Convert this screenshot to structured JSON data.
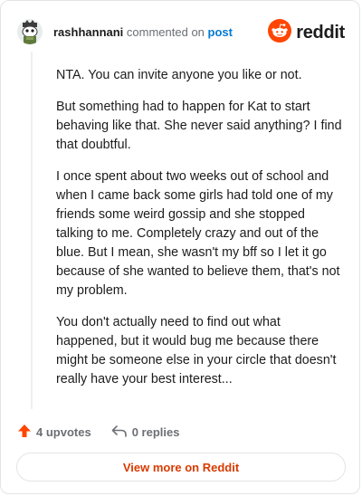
{
  "header": {
    "username": "rashhannani",
    "action_text": "commented on",
    "post_link": "post",
    "brand": "reddit"
  },
  "comment": {
    "paragraphs": [
      "NTA. You can invite anyone you like or not.",
      "But something had to happen for Kat to start behaving like that. She never said anything? I find that doubtful.",
      "I once spent about two weeks out of school and when I came back some girls had told one of my friends some weird gossip and she stopped talking to me. Completely crazy and out of the blue. But I mean, she wasn't my bff so I let it go because of she wanted to believe them, that's not my problem.",
      "You don't actually need to find out what happened, but it would bug me because there might be someone else in your circle that doesn't really have your best interest..."
    ]
  },
  "footer": {
    "upvotes": "4 upvotes",
    "replies": "0 replies",
    "view_more": "View more on Reddit"
  },
  "colors": {
    "brand_orange": "#ff4500",
    "link_blue": "#0079d3",
    "view_more_text": "#d93a00",
    "upvote_arrow": "#ff4500"
  },
  "icons": {
    "avatar": "user-avatar-icon",
    "brand": "reddit-logo-icon",
    "upvote": "upvote-arrow-icon",
    "reply": "reply-arrow-icon"
  }
}
